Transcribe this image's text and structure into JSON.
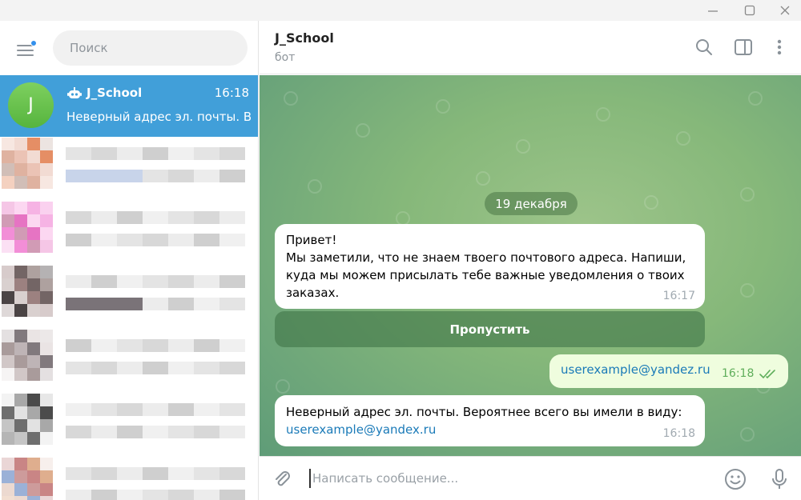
{
  "window": {
    "controls": [
      "minimize",
      "maximize",
      "close"
    ]
  },
  "sidebar": {
    "search_placeholder": "Поиск",
    "active_chat": {
      "avatar_letter": "J",
      "name": "J_School",
      "time": "16:18",
      "preview": "Неверный адрес эл. почты. Вероятнее всего вы имели в виду: userexample@yandex.ru"
    }
  },
  "header": {
    "title": "J_School",
    "subtitle": "бот"
  },
  "chat": {
    "date": "19 декабря",
    "msg1": {
      "lines": [
        "Привет!",
        "Мы заметили, что не знаем твоего почтового адреса. Напиши,",
        "куда мы можем присылать тебе важные уведомления о твоих",
        "заказах."
      ],
      "time": "16:17"
    },
    "inline_button": "Пропустить",
    "msg2": {
      "text": "userexample@yandez.ru",
      "time": "16:18",
      "status": "read"
    },
    "msg3": {
      "text": "Неверный адрес эл. почты. Вероятнее всего вы имели в виду:",
      "link": "userexample@yandex.ru",
      "time": "16:18"
    }
  },
  "composer": {
    "placeholder": "Написать сообщение..."
  },
  "colors": {
    "accent": "#419fd9",
    "outgoing_bubble": "#effdde",
    "link": "#1a7ab8",
    "check_green": "#5fae5b"
  }
}
